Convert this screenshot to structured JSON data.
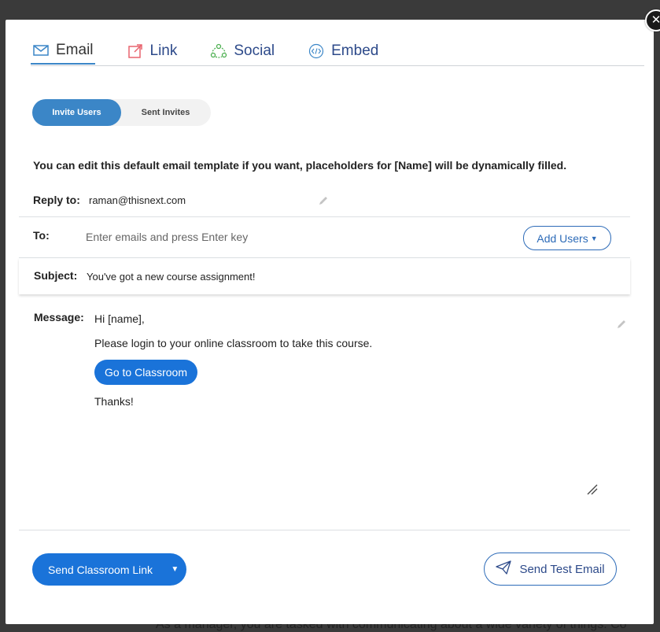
{
  "background_text": "As a manager, you are tasked with communicating about a wide variety of things. Co",
  "tabs": [
    {
      "label": "Email",
      "icon": "envelope-icon"
    },
    {
      "label": "Link",
      "icon": "external-link-icon"
    },
    {
      "label": "Social",
      "icon": "social-share-icon"
    },
    {
      "label": "Embed",
      "icon": "code-embed-icon"
    }
  ],
  "toggle": {
    "invite": "Invite Users",
    "sent": "Sent Invites"
  },
  "info_text": "You can edit this default email template if you want, placeholders for [Name] will be dynamically filled.",
  "reply": {
    "label": "Reply to:",
    "value": "raman@thisnext.com"
  },
  "to": {
    "label": "To:",
    "placeholder": "Enter emails and press Enter key",
    "add_users": "Add Users"
  },
  "subject": {
    "label": "Subject:",
    "value": "You've got a new course assignment!"
  },
  "message": {
    "label": "Message:",
    "greeting": "Hi [name],",
    "body": "Please login to your online classroom to take this course.",
    "button": "Go to Classroom",
    "closing": "Thanks!"
  },
  "footer": {
    "send_link": "Send Classroom Link",
    "send_test": "Send Test Email"
  },
  "colors": {
    "accent": "#1a73d9",
    "tab_text": "#2d4a8a",
    "toggle_active": "#3b86c7"
  }
}
